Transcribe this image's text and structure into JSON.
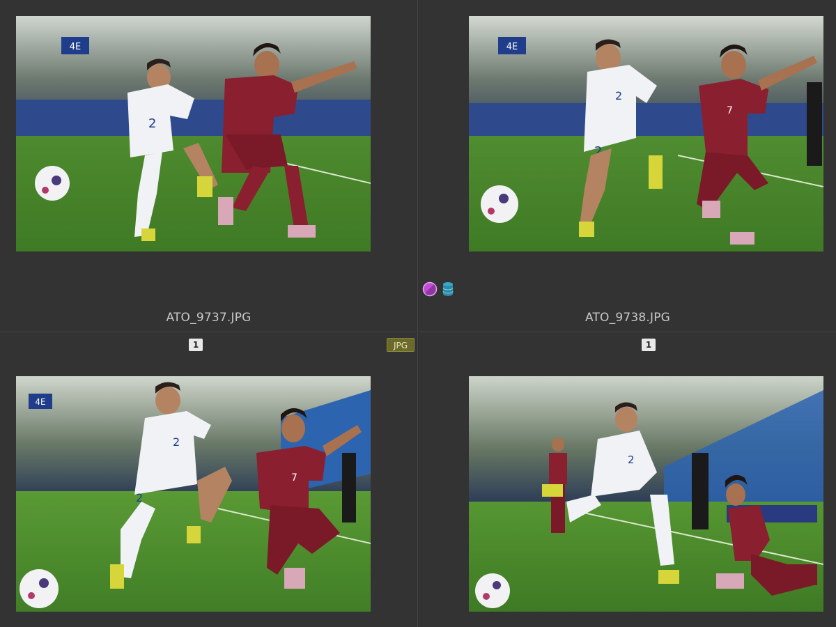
{
  "thumbnails": [
    {
      "filename": "ATO_9737.JPG",
      "rating": "",
      "format": "",
      "image": "soccer-photo-white-2-vs-red-tackle"
    },
    {
      "filename": "ATO_9738.JPG",
      "rating": "",
      "format": "",
      "image": "soccer-photo-white-2-vs-red-7-tackle"
    },
    {
      "filename": "",
      "rating": "1",
      "format": "JPG",
      "image": "soccer-photo-white-2-vs-red-7-falling"
    },
    {
      "filename": "",
      "rating": "1",
      "format": "",
      "image": "soccer-photo-white-2-running-red-7-on-ground"
    }
  ],
  "status_icons": [
    {
      "name": "color-label-icon",
      "color": "#c24bd6"
    },
    {
      "name": "database-icon",
      "color": "#38a7c8"
    }
  ],
  "colors": {
    "background": "#333333",
    "divider": "#454545",
    "filename_text": "#c8c8c8",
    "badge_bg": "#6b6a2a",
    "rating_bg": "#e9e9e9"
  }
}
